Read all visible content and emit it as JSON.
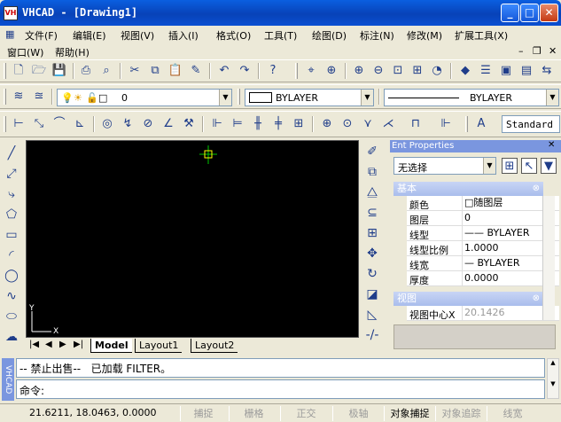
{
  "window": {
    "title": "VHCAD - [Drawing1]",
    "app_icon_label": "VH"
  },
  "menu": {
    "items": [
      "文件(F)",
      "编辑(E)",
      "视图(V)",
      "插入(I)",
      "格式(O)",
      "工具(T)",
      "绘图(D)",
      "标注(N)",
      "修改(M)",
      "扩展工具(X)"
    ],
    "row2": [
      "窗口(W)",
      "帮助(H)"
    ]
  },
  "layers": {
    "current_layer": "0",
    "color": "BYLAYER",
    "linetype": "BYLAYER"
  },
  "style": {
    "text_style": "Standard"
  },
  "layout_tabs": [
    "Model",
    "Layout1",
    "Layout2"
  ],
  "properties": {
    "panel_title": "Ent Properties",
    "selection": "无选择",
    "sections": {
      "basic": "基本",
      "view": "视图"
    },
    "rows": [
      {
        "key": "颜色",
        "value": "随图层"
      },
      {
        "key": "图层",
        "value": "0"
      },
      {
        "key": "线型",
        "value": "BYLAYER"
      },
      {
        "key": "线型比例",
        "value": "1.0000"
      },
      {
        "key": "线宽",
        "value": "BYLAYER"
      },
      {
        "key": "厚度",
        "value": "0.0000"
      }
    ],
    "view_rows": [
      {
        "key": "视图中心X",
        "value": "20.1426"
      }
    ]
  },
  "command": {
    "history": "-- 禁止出售--   已加载 FILTER。",
    "prompt": "命令:",
    "side_label": "VHCAD"
  },
  "status": {
    "coords": "21.6211, 18.0463, 0.0000",
    "buttons": [
      {
        "label": "捕捉",
        "on": false
      },
      {
        "label": "栅格",
        "on": false
      },
      {
        "label": "正交",
        "on": false
      },
      {
        "label": "极轴",
        "on": false
      },
      {
        "label": "对象捕捉",
        "on": true
      },
      {
        "label": "对象追踪",
        "on": false
      },
      {
        "label": "线宽",
        "on": false
      }
    ]
  },
  "canvas": {
    "ucs_x": "X",
    "ucs_y": "Y",
    "background": "#000000",
    "crosshair_color": "#00c800",
    "cursor_box_color": "#ffff00"
  }
}
